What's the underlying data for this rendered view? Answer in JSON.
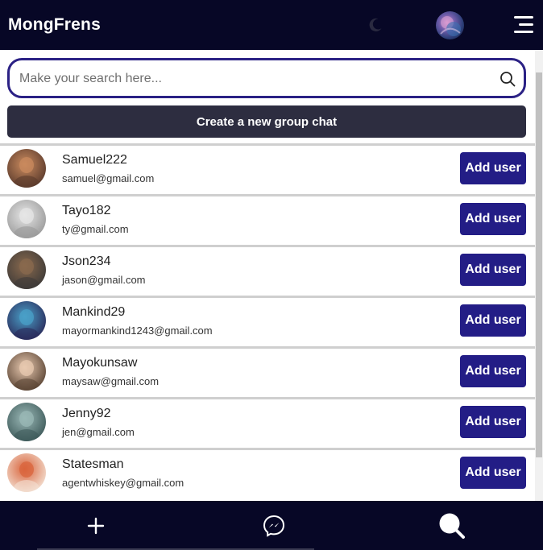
{
  "header": {
    "brand": "MongFrens",
    "icons": [
      "moon-icon",
      "profile-avatar",
      "hamburger-menu-icon"
    ]
  },
  "search": {
    "placeholder": "Make your search here...",
    "value": "",
    "icon": "search-icon"
  },
  "create_group_label": "Create a new group chat",
  "users": [
    {
      "name": "Samuel222",
      "email": "samuel@gmail.com",
      "action": "Add user",
      "avatar_colors": [
        "#c98a5e",
        "#5a3a2c"
      ]
    },
    {
      "name": "Tayo182",
      "email": "ty@gmail.com",
      "action": "Add user",
      "avatar_colors": [
        "#e6e6e6",
        "#9a9a9a"
      ]
    },
    {
      "name": "Json234",
      "email": "jason@gmail.com",
      "action": "Add user",
      "avatar_colors": [
        "#8a6a4e",
        "#3d3a38"
      ]
    },
    {
      "name": "Mankind29",
      "email": "mayormankind1243@gmail.com",
      "action": "Add user",
      "avatar_colors": [
        "#4aa0c8",
        "#2a2a5a"
      ]
    },
    {
      "name": "Mayokunsaw",
      "email": "maysaw@gmail.com",
      "action": "Add user",
      "avatar_colors": [
        "#e8c9b0",
        "#5a4434"
      ]
    },
    {
      "name": "Jenny92",
      "email": "jen@gmail.com",
      "action": "Add user",
      "avatar_colors": [
        "#9ab8b6",
        "#3e5a5a"
      ]
    },
    {
      "name": "Statesman",
      "email": "agentwhiskey@gmail.com",
      "action": "Add user",
      "avatar_colors": [
        "#d9643c",
        "#f3e0d2"
      ]
    }
  ],
  "bottom_nav": {
    "items": [
      "plus-icon",
      "messenger-icon",
      "search-icon"
    ]
  },
  "colors": {
    "header_bg": "#070726",
    "accent": "#231d86",
    "search_border": "#2b2185",
    "create_button_bg": "#2d2d40"
  }
}
